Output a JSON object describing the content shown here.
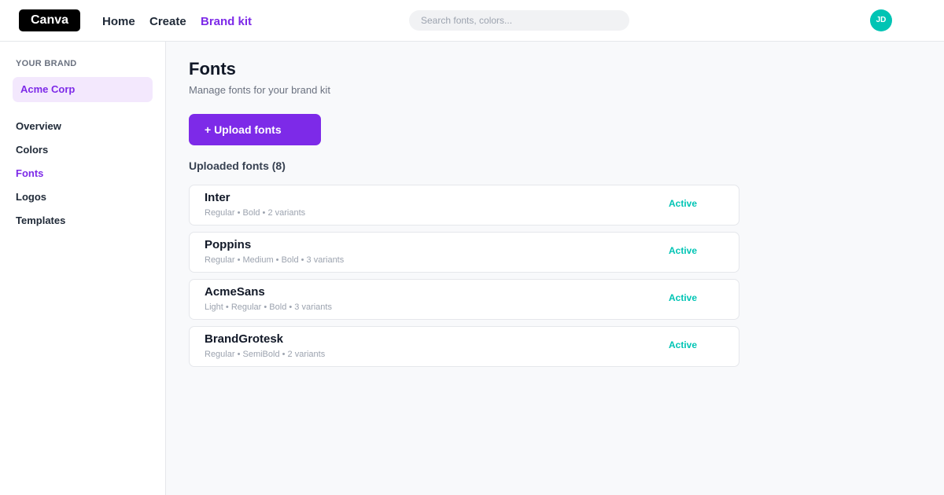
{
  "colors": {
    "accent": "#7d2ae8",
    "teal": "#00c4b4",
    "logo_bg": "#000000"
  },
  "topbar": {
    "logo": "Canva",
    "nav": [
      "Home",
      "Create",
      "Brand kit"
    ],
    "active_nav": "Brand kit",
    "search": {
      "placeholder": "Search fonts, colors...",
      "value": ""
    },
    "avatar_initials": "JD"
  },
  "sidebar": {
    "heading": "YOUR BRAND",
    "brand": "Acme Corp",
    "items": [
      "Overview",
      "Colors",
      "Fonts",
      "Logos",
      "Templates"
    ],
    "active_item": "Fonts"
  },
  "main": {
    "title": "Fonts",
    "subtitle": "Manage fonts for your brand kit",
    "upload_label": "+ Upload fonts",
    "section_label": "Uploaded fonts (8)",
    "fonts": [
      {
        "name": "Inter",
        "meta": "Regular • Bold • 2 variants",
        "status": "Active"
      },
      {
        "name": "Poppins",
        "meta": "Regular • Medium • Bold • 3 variants",
        "status": "Active"
      },
      {
        "name": "AcmeSans",
        "meta": "Light • Regular • Bold • 3 variants",
        "status": "Active"
      },
      {
        "name": "BrandGrotesk",
        "meta": "Regular • SemiBold • 2 variants",
        "status": "Active"
      }
    ]
  }
}
